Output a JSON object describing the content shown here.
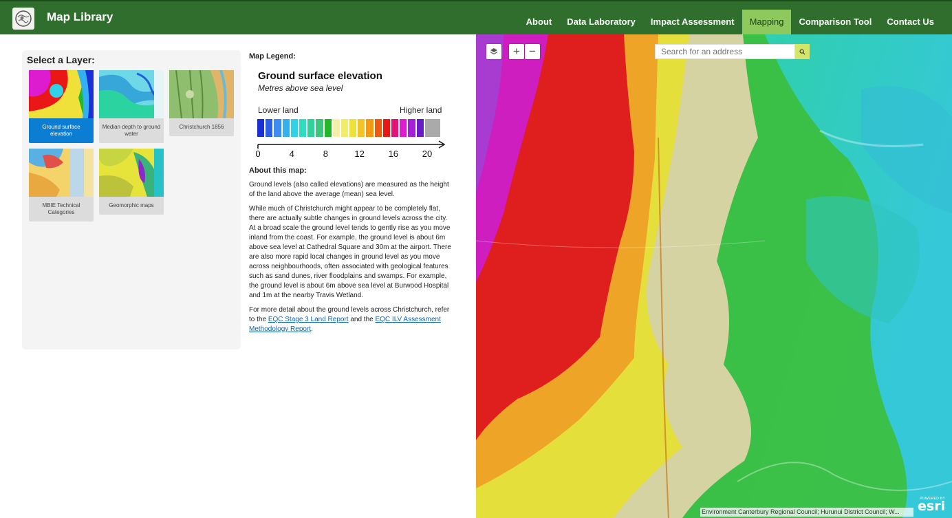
{
  "header": {
    "brand": "Map Library",
    "nav": [
      "About",
      "Data Laboratory",
      "Impact Assessment",
      "Mapping",
      "Comparison Tool",
      "Contact Us"
    ],
    "active_nav": "Mapping"
  },
  "layers": {
    "title": "Select a Layer:",
    "items": [
      {
        "label": "Ground surface elevation",
        "selected": true
      },
      {
        "label": "Median depth to ground water",
        "selected": false
      },
      {
        "label": "Christchurch 1856",
        "selected": false
      },
      {
        "label": "MBIE Technical Categories",
        "selected": false
      },
      {
        "label": "Geomorphic maps",
        "selected": false
      }
    ]
  },
  "legend": {
    "heading": "Map Legend:",
    "title": "Ground surface elevation",
    "subtitle": "Metres above sea level",
    "lower_label": "Lower land",
    "higher_label": "Higher land",
    "colors": [
      "#1b2fd6",
      "#2b5fe6",
      "#3e8cf0",
      "#35b0ef",
      "#2fd2e6",
      "#30dcc0",
      "#2fd39a",
      "#3cc77a",
      "#22b82a",
      "#f5f0a8",
      "#f1ec6e",
      "#f0e13a",
      "#f4c422",
      "#f29a12",
      "#ee5b10",
      "#ea1717",
      "#e2147a",
      "#dd1cd0",
      "#a51fd8",
      "#6a1bc8",
      "#aaaaaa"
    ],
    "ticks": [
      "0",
      "4",
      "8",
      "12",
      "16",
      "20"
    ]
  },
  "about": {
    "heading": "About this map:",
    "p1": "Ground levels (also called elevations) are measured as the height of the land above the average (mean) sea level.",
    "p2": "While much of Christchurch might appear to be completely flat, there are actually subtle changes in ground levels across the city. At a broad scale the ground level tends to gently rise as you move inland from the coast. For example, the ground level is about 6m above sea level at Cathedral Square and 30m at the airport. There are also more rapid local changes in ground level as you move across neighbourhoods, often associated with geological features such as sand dunes, river floodplains and swamps. For example, the ground level is about 6m above sea level at Burwood Hospital and 1m at the nearby Travis Wetland.",
    "p3_a": "For more detail about the ground levels across Christchurch, refer to the ",
    "link1": "EQC Stage 3 Land Report",
    "p3_b": " and the ",
    "link2": "EQC ILV Assessment Methodology Report",
    "p3_c": "."
  },
  "map": {
    "search_placeholder": "Search for an address",
    "attribution": "Environment Canterbury Regional Council; Hurunui District Council; W...",
    "powered_by": "POWERED BY",
    "esri": "esri",
    "zoom_in": "+",
    "zoom_out": "−"
  }
}
